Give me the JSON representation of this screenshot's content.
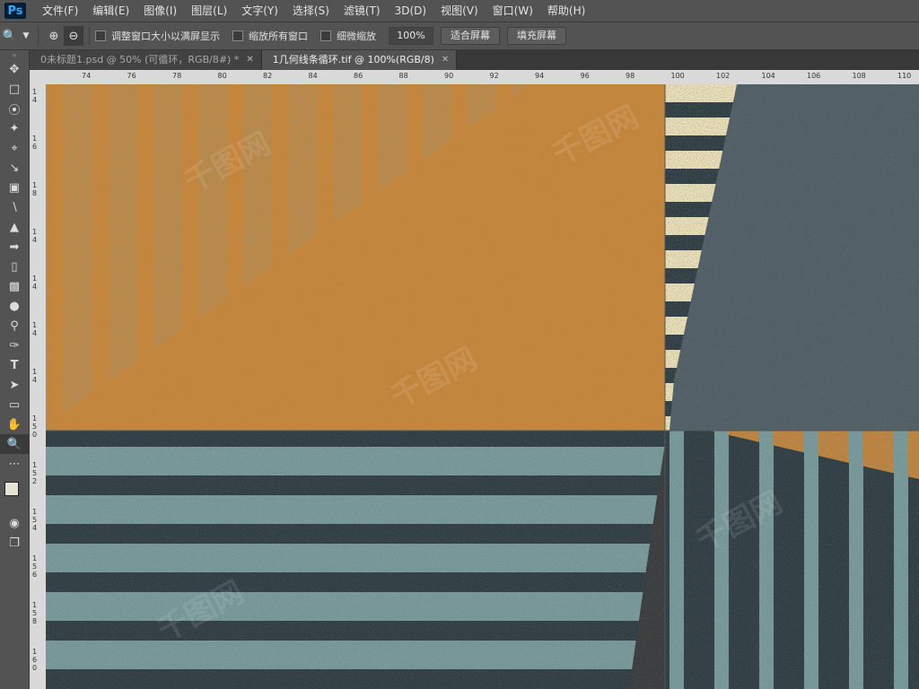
{
  "app": {
    "logo": "Ps"
  },
  "menu": [
    "文件(F)",
    "编辑(E)",
    "图像(I)",
    "图层(L)",
    "文字(Y)",
    "选择(S)",
    "滤镜(T)",
    "3D(D)",
    "视图(V)",
    "窗口(W)",
    "帮助(H)"
  ],
  "options": {
    "resize_windows": "调整窗口大小以满屏显示",
    "zoom_all": "缩放所有窗口",
    "scrubby_zoom": "细微缩放",
    "zoom_value": "100%",
    "fit_screen": "适合屏幕",
    "fill_screen": "填充屏幕"
  },
  "tabs": [
    {
      "label": "0未标题1.psd @ 50% (可循环，RGB/8#) *",
      "active": false
    },
    {
      "label": "1几何线条循环.tif @ 100%(RGB/8)",
      "active": true
    }
  ],
  "ruler_h_ticks": [
    "74",
    "76",
    "78",
    "80",
    "82",
    "84",
    "86",
    "88",
    "90",
    "92",
    "94",
    "96",
    "98",
    "100",
    "102",
    "104",
    "106",
    "108",
    "110"
  ],
  "ruler_v_ticks": [
    "14",
    "16",
    "18",
    "1 4",
    "1 4",
    "1 4",
    "1 4",
    "1 5 0",
    "1 5 2",
    "1 5 4",
    "1 5 6",
    "1 5 8",
    "1 6 0"
  ],
  "watermark": "千图网",
  "colors": {
    "orange": "#c4873e",
    "teal": "#7b9c9d",
    "dark": "#2f3f44",
    "cream": "#f0e3b8",
    "slate": "#5a6870"
  }
}
